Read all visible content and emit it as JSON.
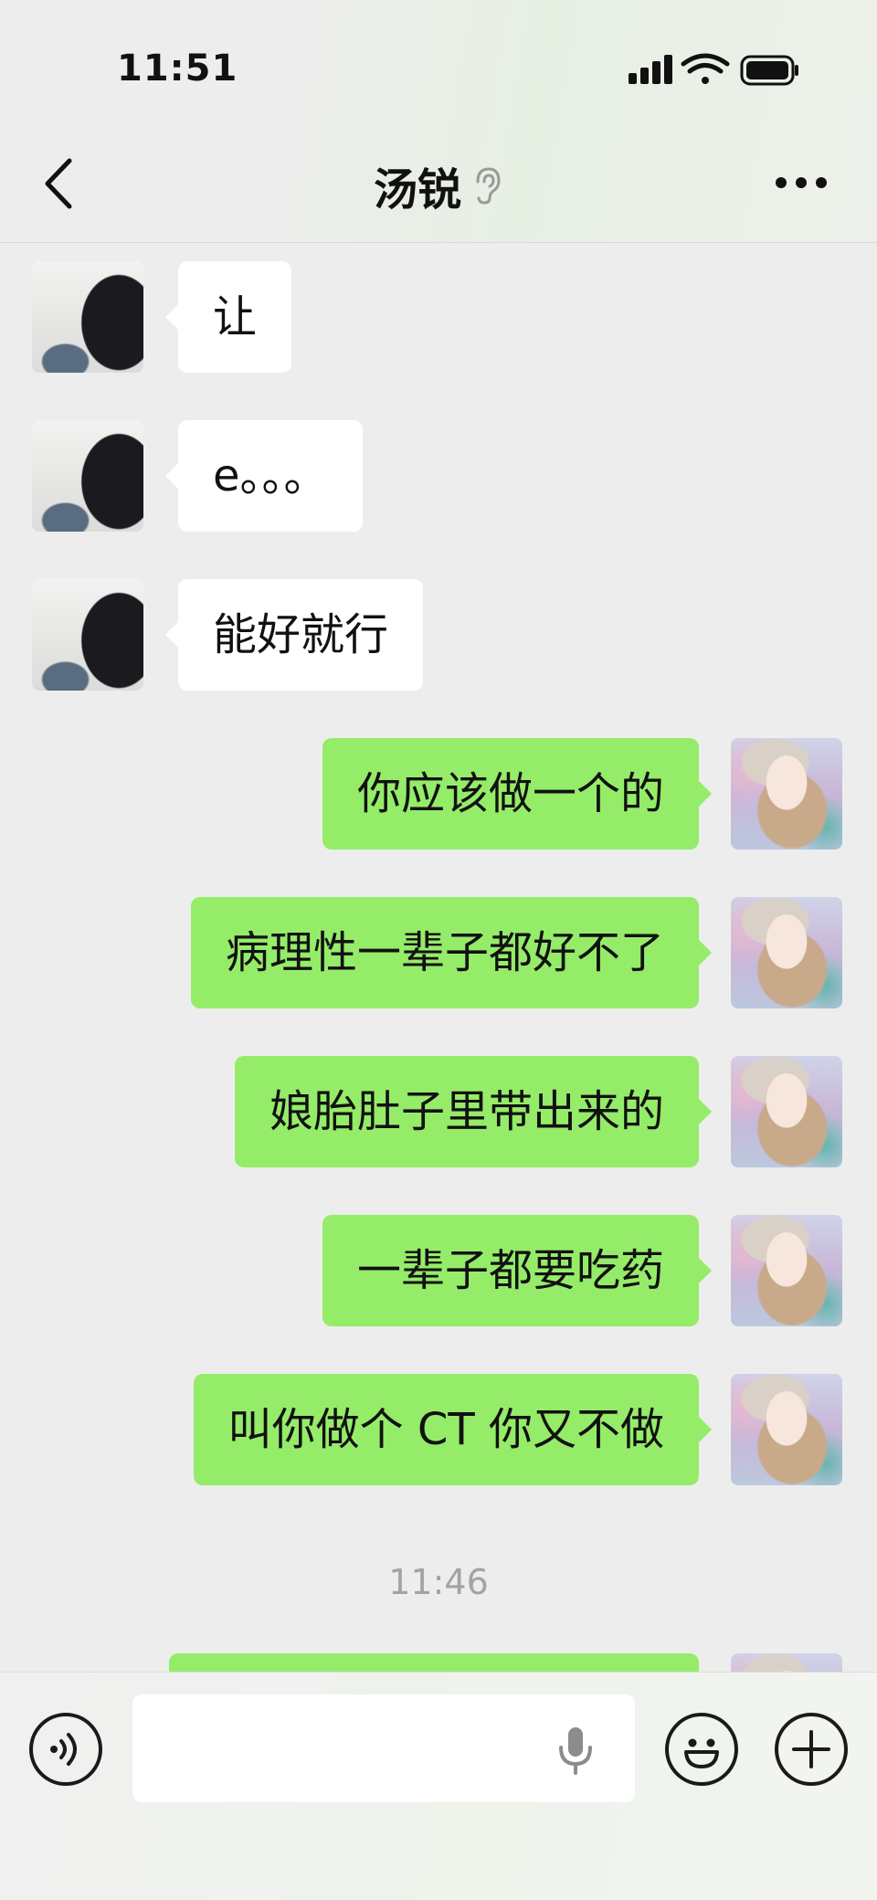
{
  "status_bar": {
    "time": "11:51",
    "icons": [
      "cellular-signal-icon",
      "wifi-icon",
      "battery-icon"
    ]
  },
  "nav": {
    "back_icon": "chevron-left-icon",
    "title": "汤锐",
    "title_icon": "ear-icon",
    "more_icon": "more-dots-icon"
  },
  "messages": [
    {
      "side": "left",
      "text": "让"
    },
    {
      "side": "left",
      "text": "e。。。"
    },
    {
      "side": "left",
      "text": "能好就行"
    },
    {
      "side": "right",
      "text": "你应该做一个的"
    },
    {
      "side": "right",
      "text": "病理性一辈子都好不了"
    },
    {
      "side": "right",
      "text": "娘胎肚子里带出来的"
    },
    {
      "side": "right",
      "text": "一辈子都要吃药"
    },
    {
      "side": "right",
      "text": "叫你做个 CT 你又不做"
    }
  ],
  "timestamp": "11:46",
  "input_bar": {
    "voice_icon": "voice-mode-icon",
    "input_value": "",
    "mic_icon": "microphone-icon",
    "emoji_icon": "emoji-icon",
    "plus_icon": "plus-icon"
  },
  "colors": {
    "background": "#ededed",
    "incoming_bubble": "#ffffff",
    "outgoing_bubble": "#95ec69",
    "timestamp": "#a3a3a3"
  }
}
